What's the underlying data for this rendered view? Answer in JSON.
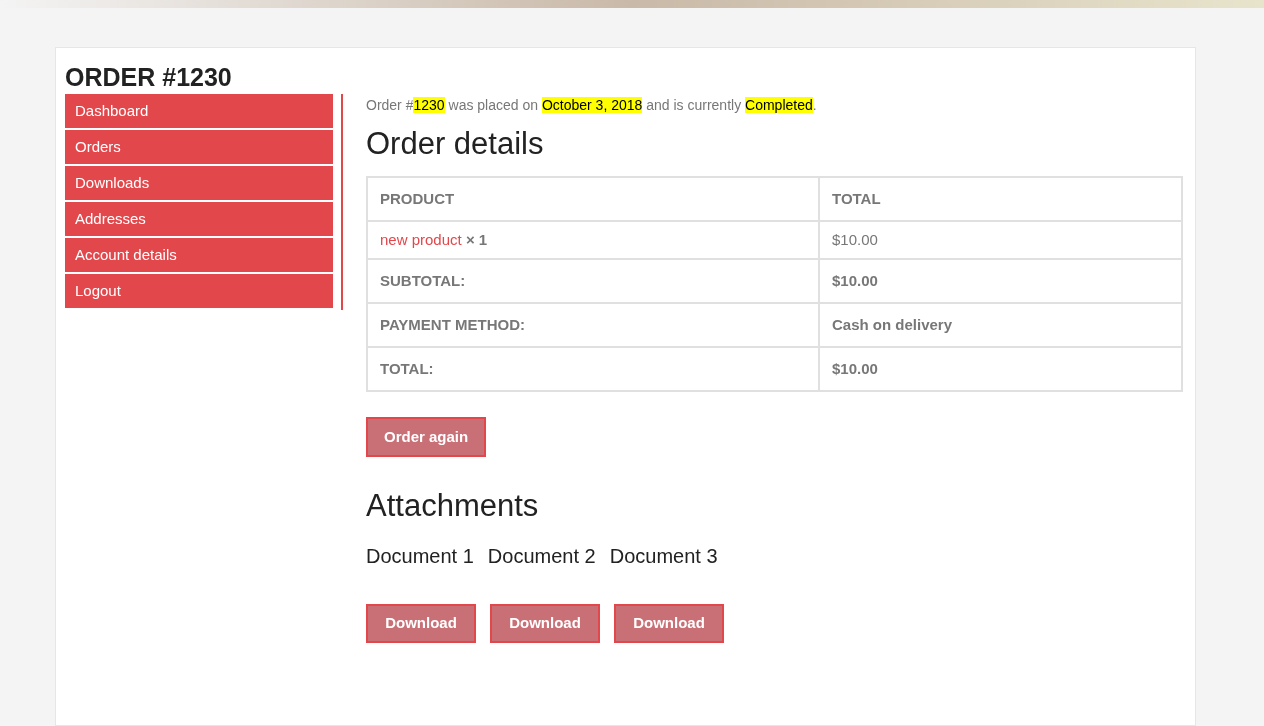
{
  "page_title": "ORDER #1230",
  "menu": [
    {
      "label": "Dashboard"
    },
    {
      "label": "Orders"
    },
    {
      "label": "Downloads"
    },
    {
      "label": "Addresses"
    },
    {
      "label": "Account details"
    },
    {
      "label": "Logout"
    }
  ],
  "notice": [
    {
      "text": "Order #",
      "highlight": false
    },
    {
      "text": "1230",
      "highlight": true
    },
    {
      "text": " was placed on ",
      "highlight": false
    },
    {
      "text": "October 3, 2018",
      "highlight": true
    },
    {
      "text": " and is currently ",
      "highlight": false
    },
    {
      "text": "Completed",
      "highlight": true
    },
    {
      "text": ".",
      "highlight": false
    }
  ],
  "order_details": {
    "heading": "Order details",
    "columns": [
      "PRODUCT",
      "TOTAL"
    ],
    "items": [
      {
        "product": "new product",
        "quantity": "× 1",
        "total": "$10.00"
      }
    ],
    "totals": [
      {
        "label": "SUBTOTAL:",
        "value": "$10.00"
      },
      {
        "label": "PAYMENT METHOD:",
        "value": "Cash on delivery"
      },
      {
        "label": "TOTAL:",
        "value": "$10.00"
      }
    ]
  },
  "order_again_button": "Order again",
  "attachments": {
    "heading": "Attachments",
    "documents": [
      {
        "name": "Document 1",
        "button": "Download"
      },
      {
        "name": "Document 2",
        "button": "Download"
      },
      {
        "name": "Document 3",
        "button": "Download"
      }
    ]
  }
}
